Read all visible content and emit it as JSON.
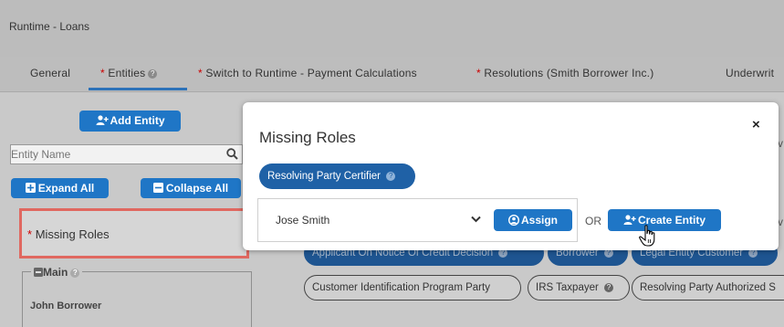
{
  "window": {
    "title": "Runtime - Loans"
  },
  "tabs": [
    {
      "label": "General",
      "required": ""
    },
    {
      "label": "Entities",
      "required": "*"
    },
    {
      "label": "Switch to Runtime - Payment Calculations",
      "required": "*"
    },
    {
      "label": "Resolutions (Smith Borrower Inc.)",
      "required": "*"
    },
    {
      "label": "Underwrit",
      "required": ""
    }
  ],
  "sidebar": {
    "add_entity_label": "Add Entity",
    "search_placeholder": "Entity Name",
    "expand_all_label": "Expand All",
    "collapse_all_label": "Collapse All",
    "missing_roles": {
      "required": "*",
      "label": "Missing Roles"
    },
    "main_group_label": "Main",
    "first_entity": "John Borrower"
  },
  "modal": {
    "title": "Missing Roles",
    "close_symbol": "×",
    "role_pill": "Resolving Party Certifier",
    "entity_select_value": "Jose Smith",
    "assign_label": "Assign",
    "or_label": "OR",
    "create_entity_label": "Create Entity"
  },
  "background_roles": {
    "row1": [
      "Applicant On Notice Of Credit Decision",
      "Borrower",
      "Legal Entity Customer"
    ],
    "row2": [
      "Customer Identification Program Party",
      "IRS Taxpayer",
      "Resolving Party Authorized S"
    ]
  },
  "colors": {
    "accent": "#1f76c6",
    "highlight_border": "#e06860",
    "required": "#cc0000"
  }
}
